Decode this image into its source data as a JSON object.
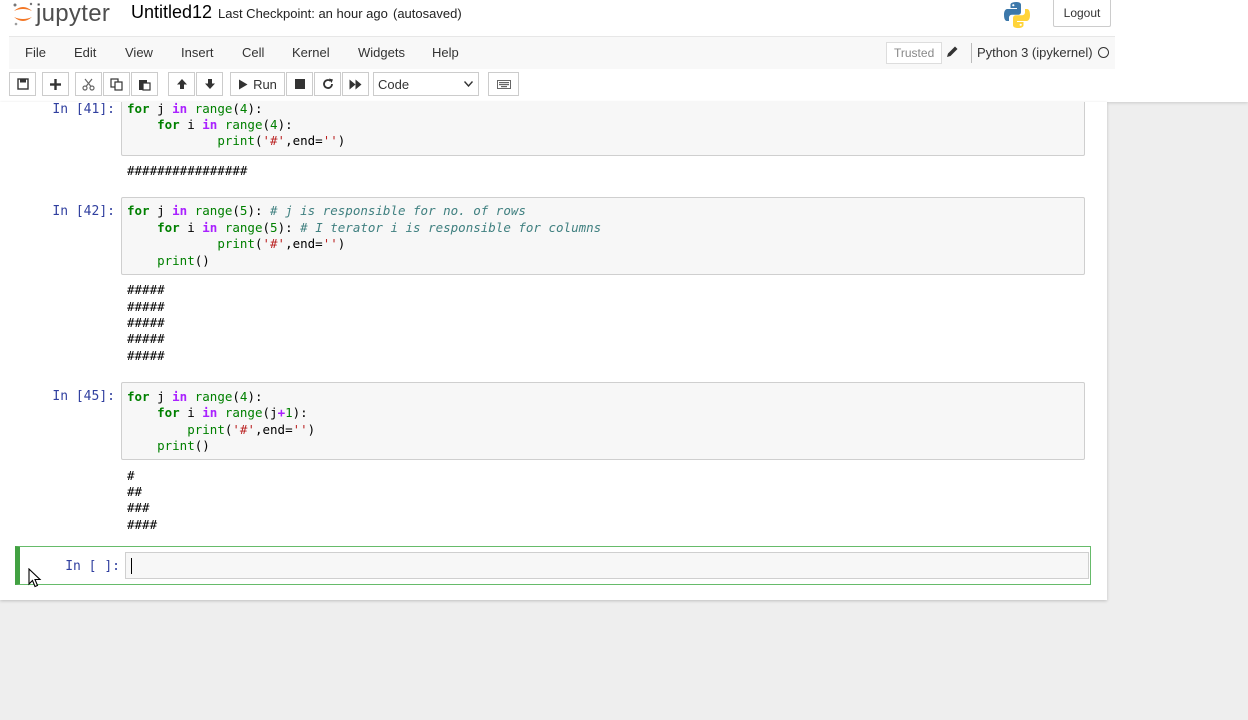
{
  "header": {
    "logo_text": "jupyter",
    "notebook_name": "Untitled12",
    "checkpoint": "Last Checkpoint: an hour ago",
    "autosave": "(autosaved)",
    "logout_label": "Logout"
  },
  "menubar": {
    "items": [
      "File",
      "Edit",
      "View",
      "Insert",
      "Cell",
      "Kernel",
      "Widgets",
      "Help"
    ],
    "trusted_label": "Trusted",
    "kernel_name": "Python 3 (ipykernel)"
  },
  "toolbar": {
    "run_label": "Run",
    "cell_type": "Code",
    "icons": [
      "save-icon",
      "plus-icon",
      "cut-icon",
      "copy-icon",
      "paste-icon",
      "arrow-up-icon",
      "arrow-down-icon",
      "play-icon",
      "stop-icon",
      "restart-icon",
      "fast-forward-icon",
      "keyboard-icon"
    ]
  },
  "cells": [
    {
      "prompt": "In [41]:",
      "code": [
        "for j in range(4):",
        "    for i in range(4):",
        "            print('#',end='')"
      ],
      "output": [
        "################"
      ]
    },
    {
      "prompt": "In [42]:",
      "code": [
        "for j in range(5): # j is responsible for no. of rows",
        "    for i in range(5): # I terator i is responsible for columns",
        "            print('#',end='')",
        "    print()"
      ],
      "output": [
        "#####",
        "#####",
        "#####",
        "#####",
        "#####"
      ]
    },
    {
      "prompt": "In [45]:",
      "code": [
        "for j in range(4):",
        "    for i in range(j+1):",
        "        print('#',end='')",
        "    print()"
      ],
      "output": [
        "#",
        "##",
        "###",
        "####"
      ]
    },
    {
      "prompt": "In [ ]:",
      "code": [
        ""
      ],
      "output": []
    }
  ],
  "colors": {
    "prompt": "#303f9f",
    "keyword": "#008000",
    "string": "#ba2121",
    "comment": "#408080",
    "active_cell_border": "#42a142"
  }
}
